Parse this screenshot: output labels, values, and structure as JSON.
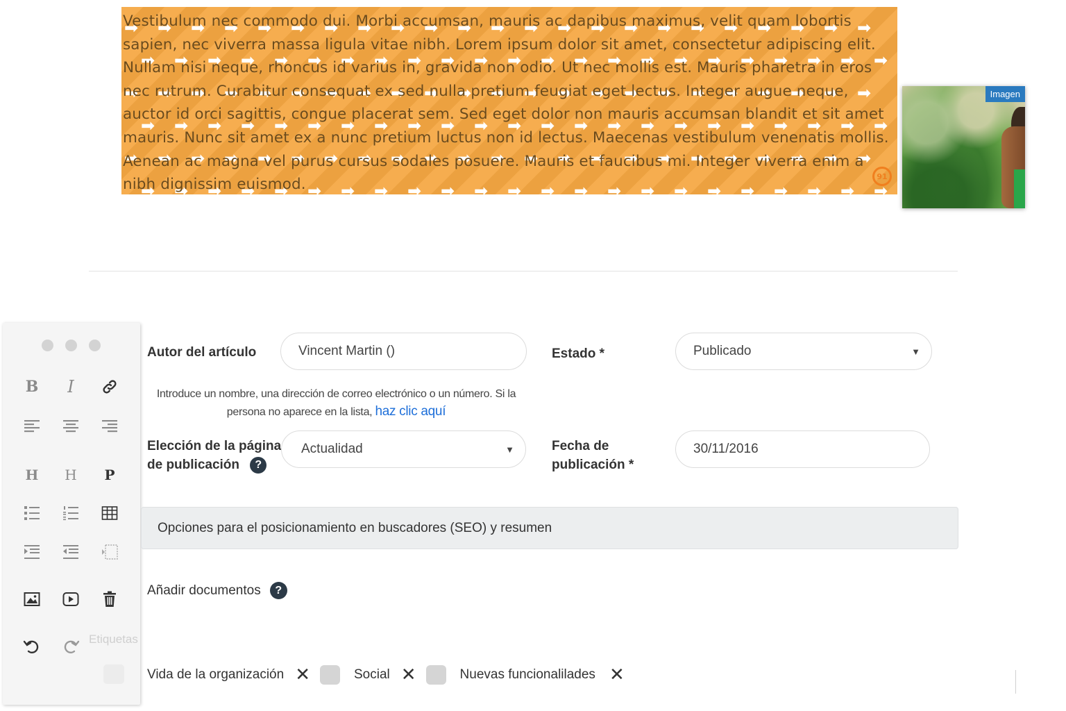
{
  "article": {
    "text": "Vestibulum nec commodo dui. Morbi accumsan, mauris ac dapibus maximus, velit quam lobortis sapien, nec viverra massa ligula vitae nibh. Lorem ipsum dolor sit amet, consectetur adipiscing elit. Nullam nisi neque, rhoncus id varius in, gravida non odio. Ut nec mollis est. Mauris pharetra in eros nec rutrum. Curabitur consequat ex sed nulla pretium feugiat eget lectus. Integer augue neque, auctor id orci sagittis, congue placerat sem. Sed eget dolor non mauris accumsan blandit et sit amet mauris. Nunc sit amet ex a nunc pretium luctus non id lectus. Maecenas vestibulum venenatis mollis. Aenean ac magna vel purus cursus sodales posuere. Mauris et faucibus mi. Integer viverra enim a nibh dignissim euismod.",
    "background_color": "#f5a742",
    "pattern_icon": "arrow-right-icon"
  },
  "image_card": {
    "tag": "Imagen"
  },
  "toolbar": {
    "heading1": "H",
    "heading2": "H",
    "paragraph": "P",
    "bold": "B",
    "italic": "I",
    "ghost_label": "Etiquetas"
  },
  "form": {
    "author": {
      "label": "Autor del artículo",
      "value": "Vincent Martin ()"
    },
    "author_hint": {
      "text": "Introduce un nombre, una dirección de correo electrónico o un número. Si la persona no aparece en la lista,",
      "link": "haz clic aquí"
    },
    "status": {
      "label": "Estado *",
      "value": "Publicado"
    },
    "page": {
      "label_line1": "Elección de la página",
      "label_line2": "de publicación",
      "value": "Actualidad"
    },
    "date": {
      "label_line1": "Fecha de",
      "label_line2": "publicación *",
      "value": "30/11/2016"
    },
    "seo_section": "Opciones para el posicionamiento en buscadores (SEO) y resumen",
    "documents_label": "Añadir documentos",
    "help_glyph": "?",
    "remove_glyph": "✕",
    "tags": [
      "Vida de la organización",
      "Social",
      "Nuevas funcionalilades"
    ]
  },
  "colors": {
    "accent_link": "#1e6fd9",
    "image_tag_bg": "#2a7abf",
    "help_icon_bg": "#2c3a47"
  }
}
